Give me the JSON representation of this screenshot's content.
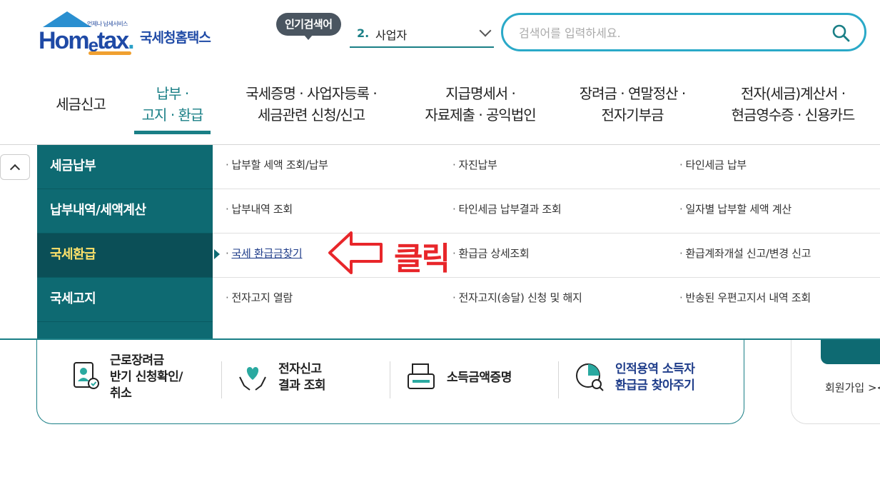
{
  "logo": {
    "sub": "언제나 납세서비스",
    "main_prefix": "Hom",
    "main_e": "e",
    "main_suffix": "tax",
    "dot": ".",
    "korean": "국세청홈택스"
  },
  "popular": {
    "label": "인기검색어",
    "rank": "2.",
    "keyword": "사업자"
  },
  "search": {
    "placeholder": "검색어를 입력하세요."
  },
  "nav": {
    "items": [
      {
        "line1": "세금신고",
        "line2": ""
      },
      {
        "line1": "납부 ·",
        "line2": "고지 · 환급"
      },
      {
        "line1": "국세증명 · 사업자등록 ·",
        "line2": "세금관련 신청/신고"
      },
      {
        "line1": "지급명세서 ·",
        "line2": "자료제출 · 공익법인"
      },
      {
        "line1": "장려금 · 연말정산 ·",
        "line2": "전자기부금"
      },
      {
        "line1": "전자(세금)계산서 ·",
        "line2": "현금영수증 · 신용카드"
      }
    ]
  },
  "mega": {
    "side": [
      "세금납부",
      "납부내역/세액계산",
      "국세환급",
      "국세고지"
    ],
    "rows": [
      [
        "납부할 세액 조회/납부",
        "자진납부",
        "타인세금 납부"
      ],
      [
        "납부내역 조회",
        "타인세금 납부결과 조회",
        "일자별 납부할 세액 계산"
      ],
      [
        "국세 환급금찾기",
        "환급금 상세조회",
        "환급계좌개설 신고/변경 신고"
      ],
      [
        "전자고지 열람",
        "전자고지(송달) 신청 및 해지",
        "반송된 우편고지서 내역 조회"
      ]
    ],
    "bullet": "·"
  },
  "annotation": {
    "click_text": "클릭",
    "color": "#e8262a"
  },
  "quick": {
    "items": [
      {
        "line1": "근로장려금",
        "line2": "반기 신청확인/",
        "line3": "취소"
      },
      {
        "line1": "전자신고",
        "line2": "결과 조회",
        "line3": ""
      },
      {
        "line1": "소득금액증명",
        "line2": "",
        "line3": ""
      },
      {
        "line1": "인적용역 소득자",
        "line2": "환급금 찾아주기",
        "line3": ""
      }
    ]
  },
  "right_card": {
    "text": "회원가입 ><"
  },
  "colors": {
    "teal": "#1a7f86",
    "navy": "#1f3d8a",
    "accent_yellow": "#ffe26a"
  }
}
